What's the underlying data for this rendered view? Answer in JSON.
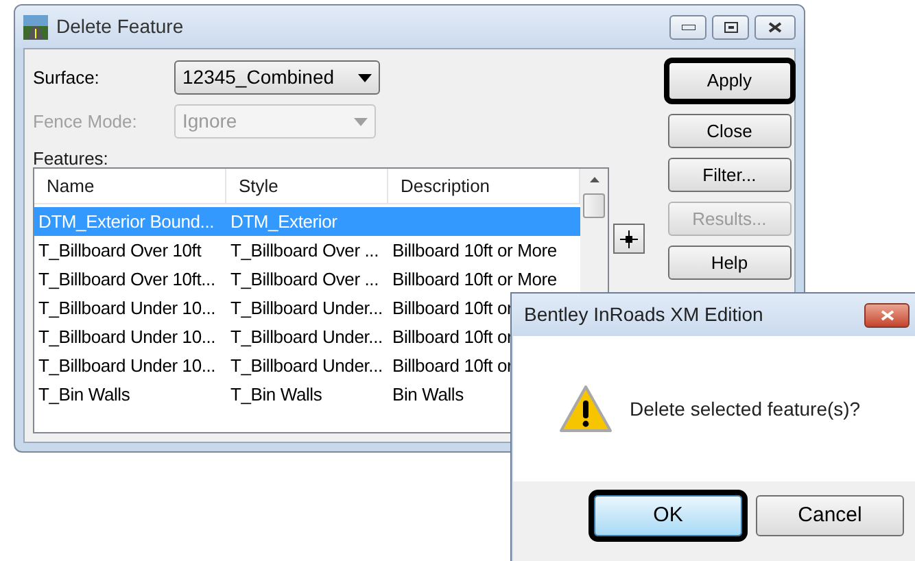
{
  "main_window": {
    "title": "Delete Feature",
    "surface": {
      "label": "Surface:",
      "value": "12345_Combined",
      "disabled": false
    },
    "fence_mode": {
      "label": "Fence Mode:",
      "value": "Ignore",
      "disabled": true
    },
    "features": {
      "label": "Features:",
      "columns": [
        "Name",
        "Style",
        "Description"
      ],
      "rows": [
        {
          "name": "DTM_Exterior Bound...",
          "style": "DTM_Exterior",
          "selected": true
        },
        {
          "name": "T_Billboard Over 10ft",
          "style": "T_Billboard Over ...",
          "description": "Billboard 10ft or More",
          "selected": false
        },
        {
          "name": "T_Billboard Over 10ft...",
          "style": "T_Billboard Over ...",
          "description": "Billboard 10ft or More",
          "selected": false
        },
        {
          "name": "T_Billboard Under 10...",
          "style": "T_Billboard Under...",
          "description": "Billboard 10ft or",
          "selected": false
        },
        {
          "name": "T_Billboard Under 10...",
          "style": "T_Billboard Under...",
          "description": "Billboard 10ft or",
          "selected": false
        },
        {
          "name": "T_Billboard Under 10...",
          "style": "T_Billboard Under...",
          "description": "Billboard 10ft or",
          "selected": false
        },
        {
          "name": "T_Bin Walls",
          "style": "T_Bin Walls",
          "description": "Bin Walls",
          "selected": false
        }
      ]
    },
    "buttons": [
      {
        "label": "Apply",
        "default": true,
        "disabled": false
      },
      {
        "label": "Close",
        "default": false,
        "disabled": false
      },
      {
        "label": "Filter...",
        "default": false,
        "disabled": false
      },
      {
        "label": "Results...",
        "default": false,
        "disabled": true
      },
      {
        "label": "Help",
        "default": false,
        "disabled": false
      }
    ]
  },
  "message_box": {
    "title": "Bentley InRoads XM Edition",
    "message": "Delete selected feature(s)?",
    "buttons": [
      {
        "label": "OK",
        "default": true
      },
      {
        "label": "Cancel",
        "default": false
      }
    ]
  }
}
